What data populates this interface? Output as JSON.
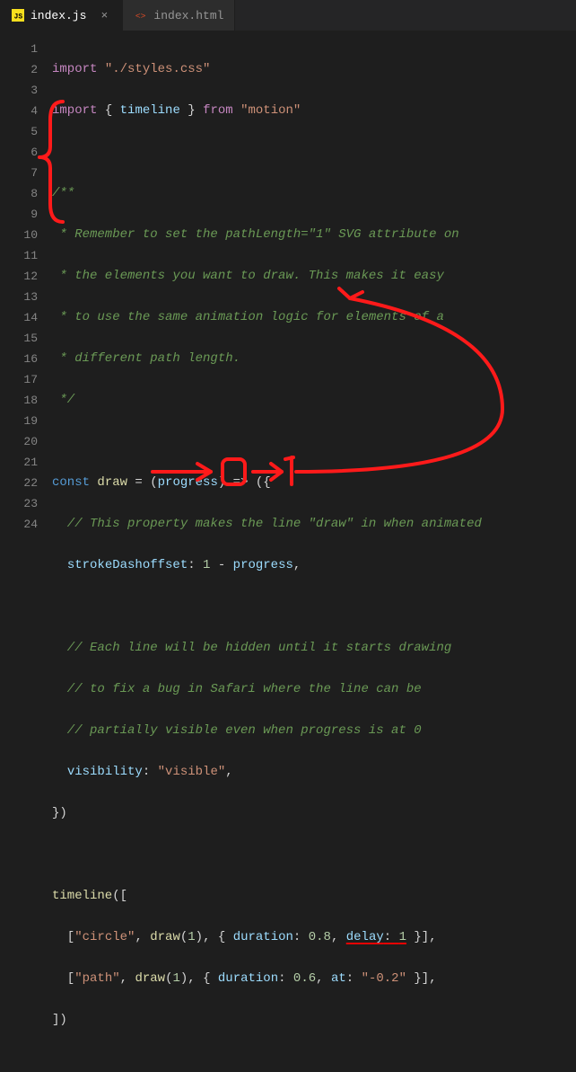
{
  "tabs": [
    {
      "label": "index.js",
      "icon": "js-icon",
      "active": true,
      "close": "×"
    },
    {
      "label": "index.html",
      "icon": "html-icon",
      "active": false,
      "close": ""
    }
  ],
  "lines": [
    "1",
    "2",
    "3",
    "4",
    "5",
    "6",
    "7",
    "8",
    "9",
    "10",
    "11",
    "12",
    "13",
    "14",
    "15",
    "16",
    "17",
    "18",
    "19",
    "20",
    "21",
    "22",
    "23",
    "24"
  ],
  "code": {
    "l1": {
      "kw1": "import",
      "str": "\"./styles.css\""
    },
    "l2": {
      "kw1": "import",
      "p1": " { ",
      "id": "timeline",
      "p2": " } ",
      "kw2": "from",
      "str": "\"motion\""
    },
    "l4": "/**",
    "l5": " * Remember to set the pathLength=\"1\" SVG attribute on",
    "l6": " * the elements you want to draw. This makes it easy",
    "l7": " * to use the same animation logic for elements of a",
    "l8": " * different path length.",
    "l9": " */",
    "l11": {
      "kw": "const",
      "id": "draw",
      "eq": " = (",
      "param": "progress",
      "arrow": ") => ({"
    },
    "l12": "  // This property makes the line \"draw\" in when animated",
    "l13": {
      "indent": "  ",
      "prop": "strokeDashoffset",
      "colon": ": ",
      "num": "1",
      "op": " - ",
      "var": "progress",
      "comma": ","
    },
    "l15": "  // Each line will be hidden until it starts drawing",
    "l16": "  // to fix a bug in Safari where the line can be",
    "l17": "  // partially visible even when progress is at 0",
    "l18": {
      "indent": "  ",
      "prop": "visibility",
      "colon": ": ",
      "str": "\"visible\"",
      "comma": ","
    },
    "l19": "})",
    "l21": {
      "fn": "timeline",
      "p": "(["
    },
    "l22": {
      "indent": "  [",
      "str1": "\"circle\"",
      "c1": ", ",
      "fn": "draw",
      "p1": "(",
      "n1": "1",
      "p2": "), { ",
      "prop1": "duration",
      "c2": ": ",
      "n2": "0.8",
      "c3": ", ",
      "prop2": "delay",
      "c4": ": ",
      "n3": "1",
      "p3": " }],"
    },
    "l23": {
      "indent": "  [",
      "str1": "\"path\"",
      "c1": ", ",
      "fn": "draw",
      "p1": "(",
      "n1": "1",
      "p2": "), { ",
      "prop1": "duration",
      "c2": ": ",
      "n2": "0.6",
      "c3": ", ",
      "prop2": "at",
      "c4": ": ",
      "str2": "\"-0.2\"",
      "p3": " }],"
    },
    "l24": "])"
  },
  "annotations": {
    "zero": "0",
    "one": "1"
  }
}
